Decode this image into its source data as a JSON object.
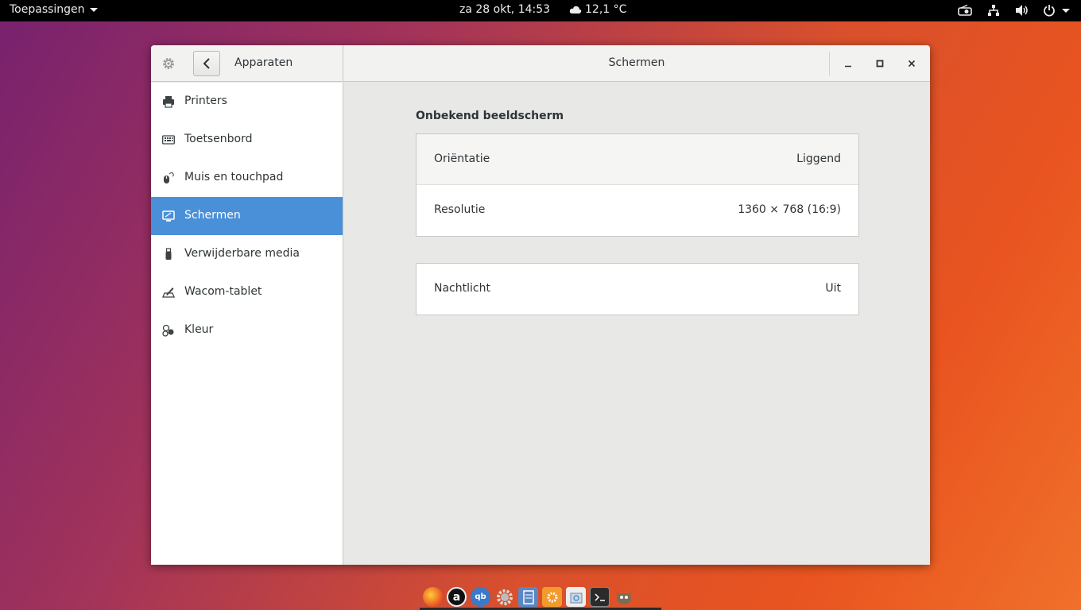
{
  "topbar": {
    "apps_label": "Toepassingen",
    "clock": "za 28 okt, 14:53",
    "weather": "12,1 °C"
  },
  "window": {
    "section": "Apparaten",
    "title": "Schermen"
  },
  "sidebar": {
    "items": [
      {
        "label": "Printers",
        "icon": "printer-icon"
      },
      {
        "label": "Toetsenbord",
        "icon": "keyboard-icon"
      },
      {
        "label": "Muis en touchpad",
        "icon": "mouse-icon"
      },
      {
        "label": "Schermen",
        "icon": "display-icon",
        "active": true
      },
      {
        "label": "Verwijderbare media",
        "icon": "usb-icon"
      },
      {
        "label": "Wacom-tablet",
        "icon": "tablet-icon"
      },
      {
        "label": "Kleur",
        "icon": "color-icon"
      }
    ]
  },
  "display": {
    "group_title": "Onbekend beeldscherm",
    "orientation_label": "Oriëntatie",
    "orientation_value": "Liggend",
    "resolution_label": "Resolutie",
    "resolution_value": "1360 × 768 (16:9)",
    "nightlight_label": "Nachtlicht",
    "nightlight_value": "Uit"
  },
  "colors": {
    "accent": "#4a90d9",
    "topbar": "#000000"
  }
}
